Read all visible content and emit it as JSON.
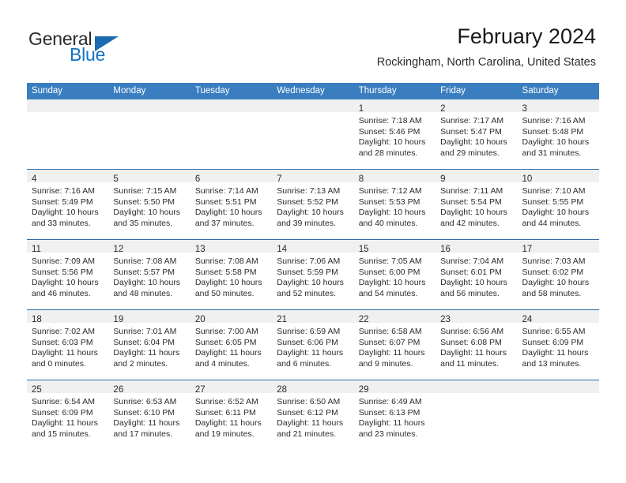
{
  "brand": {
    "name_part1": "General",
    "name_part2": "Blue",
    "accent_color": "#1273c4",
    "triangle_color": "#1b6bb0",
    "icon": "triangle-icon"
  },
  "header": {
    "title": "February 2024",
    "subtitle": "Rockingham, North Carolina, United States"
  },
  "theme": {
    "header_row_bg": "#3a7ec0",
    "week_divider": "#2e6da8",
    "day_strip_bg": "#f0f0f0",
    "text": "#2b2b2b"
  },
  "weekday_headers": [
    "Sunday",
    "Monday",
    "Tuesday",
    "Wednesday",
    "Thursday",
    "Friday",
    "Saturday"
  ],
  "weeks": [
    [
      {
        "day": "",
        "lines": []
      },
      {
        "day": "",
        "lines": []
      },
      {
        "day": "",
        "lines": []
      },
      {
        "day": "",
        "lines": []
      },
      {
        "day": "1",
        "lines": [
          "Sunrise: 7:18 AM",
          "Sunset: 5:46 PM",
          "Daylight: 10 hours",
          "and 28 minutes."
        ]
      },
      {
        "day": "2",
        "lines": [
          "Sunrise: 7:17 AM",
          "Sunset: 5:47 PM",
          "Daylight: 10 hours",
          "and 29 minutes."
        ]
      },
      {
        "day": "3",
        "lines": [
          "Sunrise: 7:16 AM",
          "Sunset: 5:48 PM",
          "Daylight: 10 hours",
          "and 31 minutes."
        ]
      }
    ],
    [
      {
        "day": "4",
        "lines": [
          "Sunrise: 7:16 AM",
          "Sunset: 5:49 PM",
          "Daylight: 10 hours",
          "and 33 minutes."
        ]
      },
      {
        "day": "5",
        "lines": [
          "Sunrise: 7:15 AM",
          "Sunset: 5:50 PM",
          "Daylight: 10 hours",
          "and 35 minutes."
        ]
      },
      {
        "day": "6",
        "lines": [
          "Sunrise: 7:14 AM",
          "Sunset: 5:51 PM",
          "Daylight: 10 hours",
          "and 37 minutes."
        ]
      },
      {
        "day": "7",
        "lines": [
          "Sunrise: 7:13 AM",
          "Sunset: 5:52 PM",
          "Daylight: 10 hours",
          "and 39 minutes."
        ]
      },
      {
        "day": "8",
        "lines": [
          "Sunrise: 7:12 AM",
          "Sunset: 5:53 PM",
          "Daylight: 10 hours",
          "and 40 minutes."
        ]
      },
      {
        "day": "9",
        "lines": [
          "Sunrise: 7:11 AM",
          "Sunset: 5:54 PM",
          "Daylight: 10 hours",
          "and 42 minutes."
        ]
      },
      {
        "day": "10",
        "lines": [
          "Sunrise: 7:10 AM",
          "Sunset: 5:55 PM",
          "Daylight: 10 hours",
          "and 44 minutes."
        ]
      }
    ],
    [
      {
        "day": "11",
        "lines": [
          "Sunrise: 7:09 AM",
          "Sunset: 5:56 PM",
          "Daylight: 10 hours",
          "and 46 minutes."
        ]
      },
      {
        "day": "12",
        "lines": [
          "Sunrise: 7:08 AM",
          "Sunset: 5:57 PM",
          "Daylight: 10 hours",
          "and 48 minutes."
        ]
      },
      {
        "day": "13",
        "lines": [
          "Sunrise: 7:08 AM",
          "Sunset: 5:58 PM",
          "Daylight: 10 hours",
          "and 50 minutes."
        ]
      },
      {
        "day": "14",
        "lines": [
          "Sunrise: 7:06 AM",
          "Sunset: 5:59 PM",
          "Daylight: 10 hours",
          "and 52 minutes."
        ]
      },
      {
        "day": "15",
        "lines": [
          "Sunrise: 7:05 AM",
          "Sunset: 6:00 PM",
          "Daylight: 10 hours",
          "and 54 minutes."
        ]
      },
      {
        "day": "16",
        "lines": [
          "Sunrise: 7:04 AM",
          "Sunset: 6:01 PM",
          "Daylight: 10 hours",
          "and 56 minutes."
        ]
      },
      {
        "day": "17",
        "lines": [
          "Sunrise: 7:03 AM",
          "Sunset: 6:02 PM",
          "Daylight: 10 hours",
          "and 58 minutes."
        ]
      }
    ],
    [
      {
        "day": "18",
        "lines": [
          "Sunrise: 7:02 AM",
          "Sunset: 6:03 PM",
          "Daylight: 11 hours",
          "and 0 minutes."
        ]
      },
      {
        "day": "19",
        "lines": [
          "Sunrise: 7:01 AM",
          "Sunset: 6:04 PM",
          "Daylight: 11 hours",
          "and 2 minutes."
        ]
      },
      {
        "day": "20",
        "lines": [
          "Sunrise: 7:00 AM",
          "Sunset: 6:05 PM",
          "Daylight: 11 hours",
          "and 4 minutes."
        ]
      },
      {
        "day": "21",
        "lines": [
          "Sunrise: 6:59 AM",
          "Sunset: 6:06 PM",
          "Daylight: 11 hours",
          "and 6 minutes."
        ]
      },
      {
        "day": "22",
        "lines": [
          "Sunrise: 6:58 AM",
          "Sunset: 6:07 PM",
          "Daylight: 11 hours",
          "and 9 minutes."
        ]
      },
      {
        "day": "23",
        "lines": [
          "Sunrise: 6:56 AM",
          "Sunset: 6:08 PM",
          "Daylight: 11 hours",
          "and 11 minutes."
        ]
      },
      {
        "day": "24",
        "lines": [
          "Sunrise: 6:55 AM",
          "Sunset: 6:09 PM",
          "Daylight: 11 hours",
          "and 13 minutes."
        ]
      }
    ],
    [
      {
        "day": "25",
        "lines": [
          "Sunrise: 6:54 AM",
          "Sunset: 6:09 PM",
          "Daylight: 11 hours",
          "and 15 minutes."
        ]
      },
      {
        "day": "26",
        "lines": [
          "Sunrise: 6:53 AM",
          "Sunset: 6:10 PM",
          "Daylight: 11 hours",
          "and 17 minutes."
        ]
      },
      {
        "day": "27",
        "lines": [
          "Sunrise: 6:52 AM",
          "Sunset: 6:11 PM",
          "Daylight: 11 hours",
          "and 19 minutes."
        ]
      },
      {
        "day": "28",
        "lines": [
          "Sunrise: 6:50 AM",
          "Sunset: 6:12 PM",
          "Daylight: 11 hours",
          "and 21 minutes."
        ]
      },
      {
        "day": "29",
        "lines": [
          "Sunrise: 6:49 AM",
          "Sunset: 6:13 PM",
          "Daylight: 11 hours",
          "and 23 minutes."
        ]
      },
      {
        "day": "",
        "lines": []
      },
      {
        "day": "",
        "lines": []
      }
    ]
  ]
}
